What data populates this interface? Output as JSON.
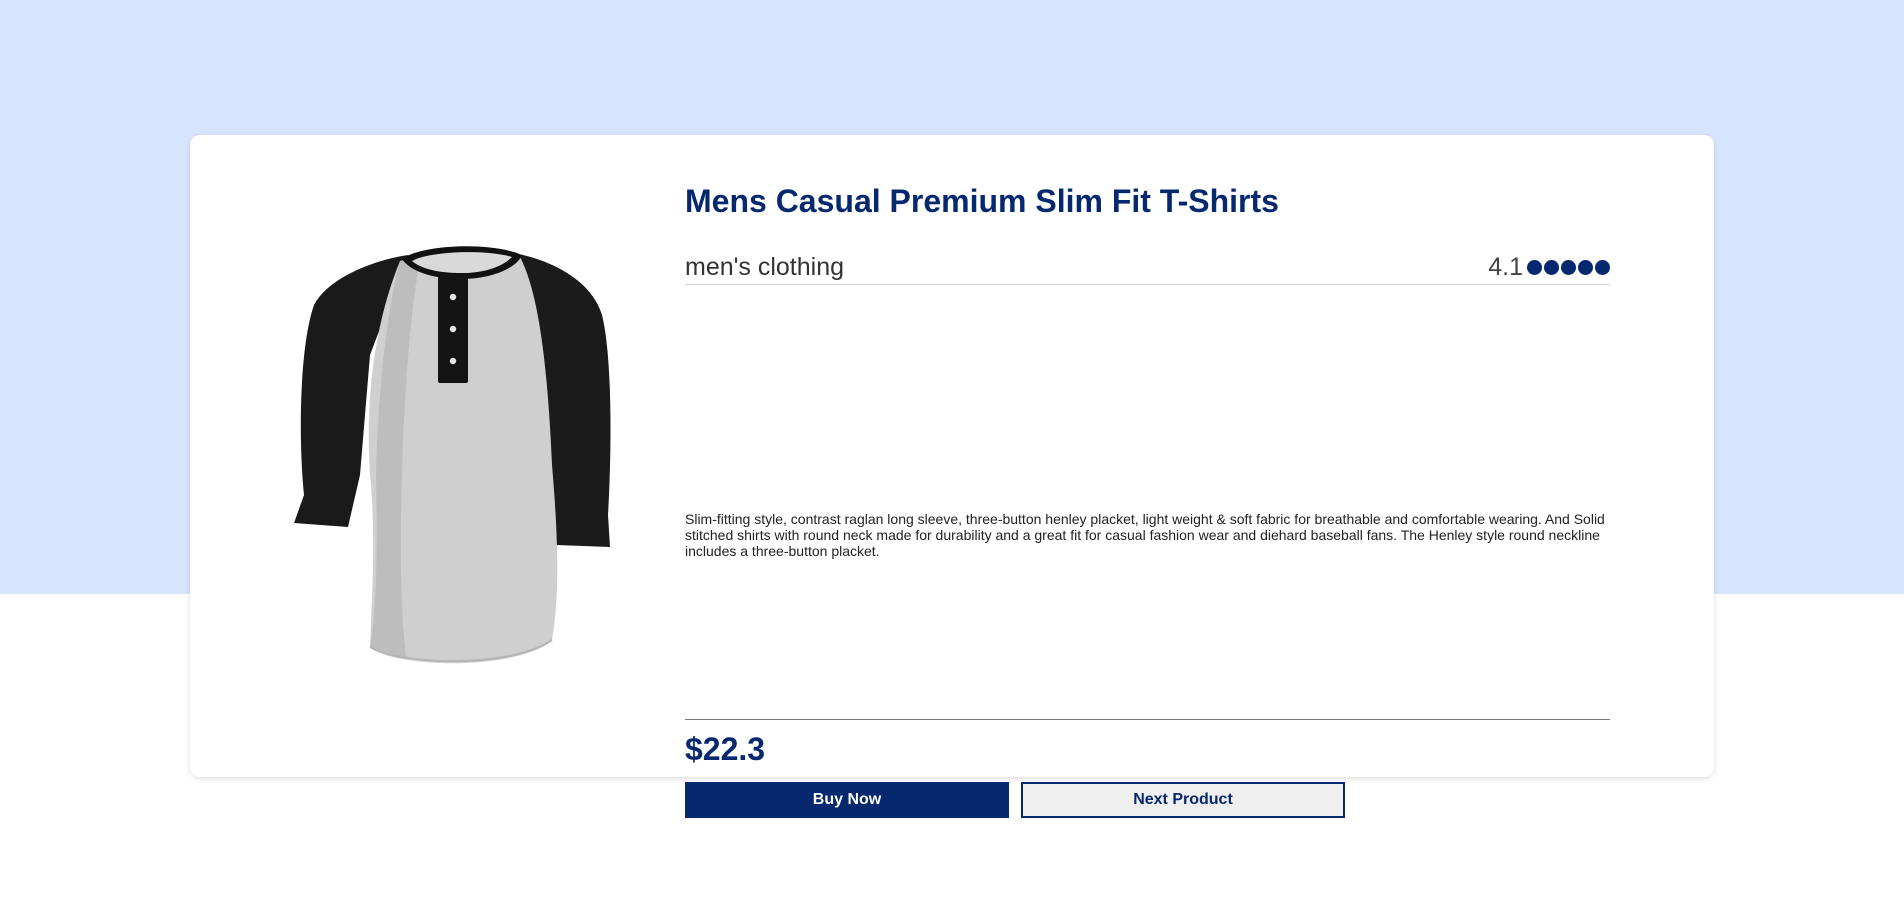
{
  "product": {
    "title": "Mens Casual Premium Slim Fit T-Shirts",
    "category": "men's clothing",
    "rating": "4.1",
    "rating_dots": 5,
    "description": "Slim-fitting style, contrast raglan long sleeve, three-button henley placket, light weight & soft fabric for breathable and comfortable wearing. And Solid stitched shirts with round neck made for durability and a great fit for casual fashion wear and diehard baseball fans. The Henley style round neckline includes a three-button placket.",
    "price": "$22.3",
    "image_subject": "raglan-henley-tshirt"
  },
  "actions": {
    "buy_label": "Buy Now",
    "next_label": "Next Product"
  },
  "colors": {
    "accent": "#06286f",
    "background_top": "#d6e4fe",
    "card": "#ffffff"
  }
}
